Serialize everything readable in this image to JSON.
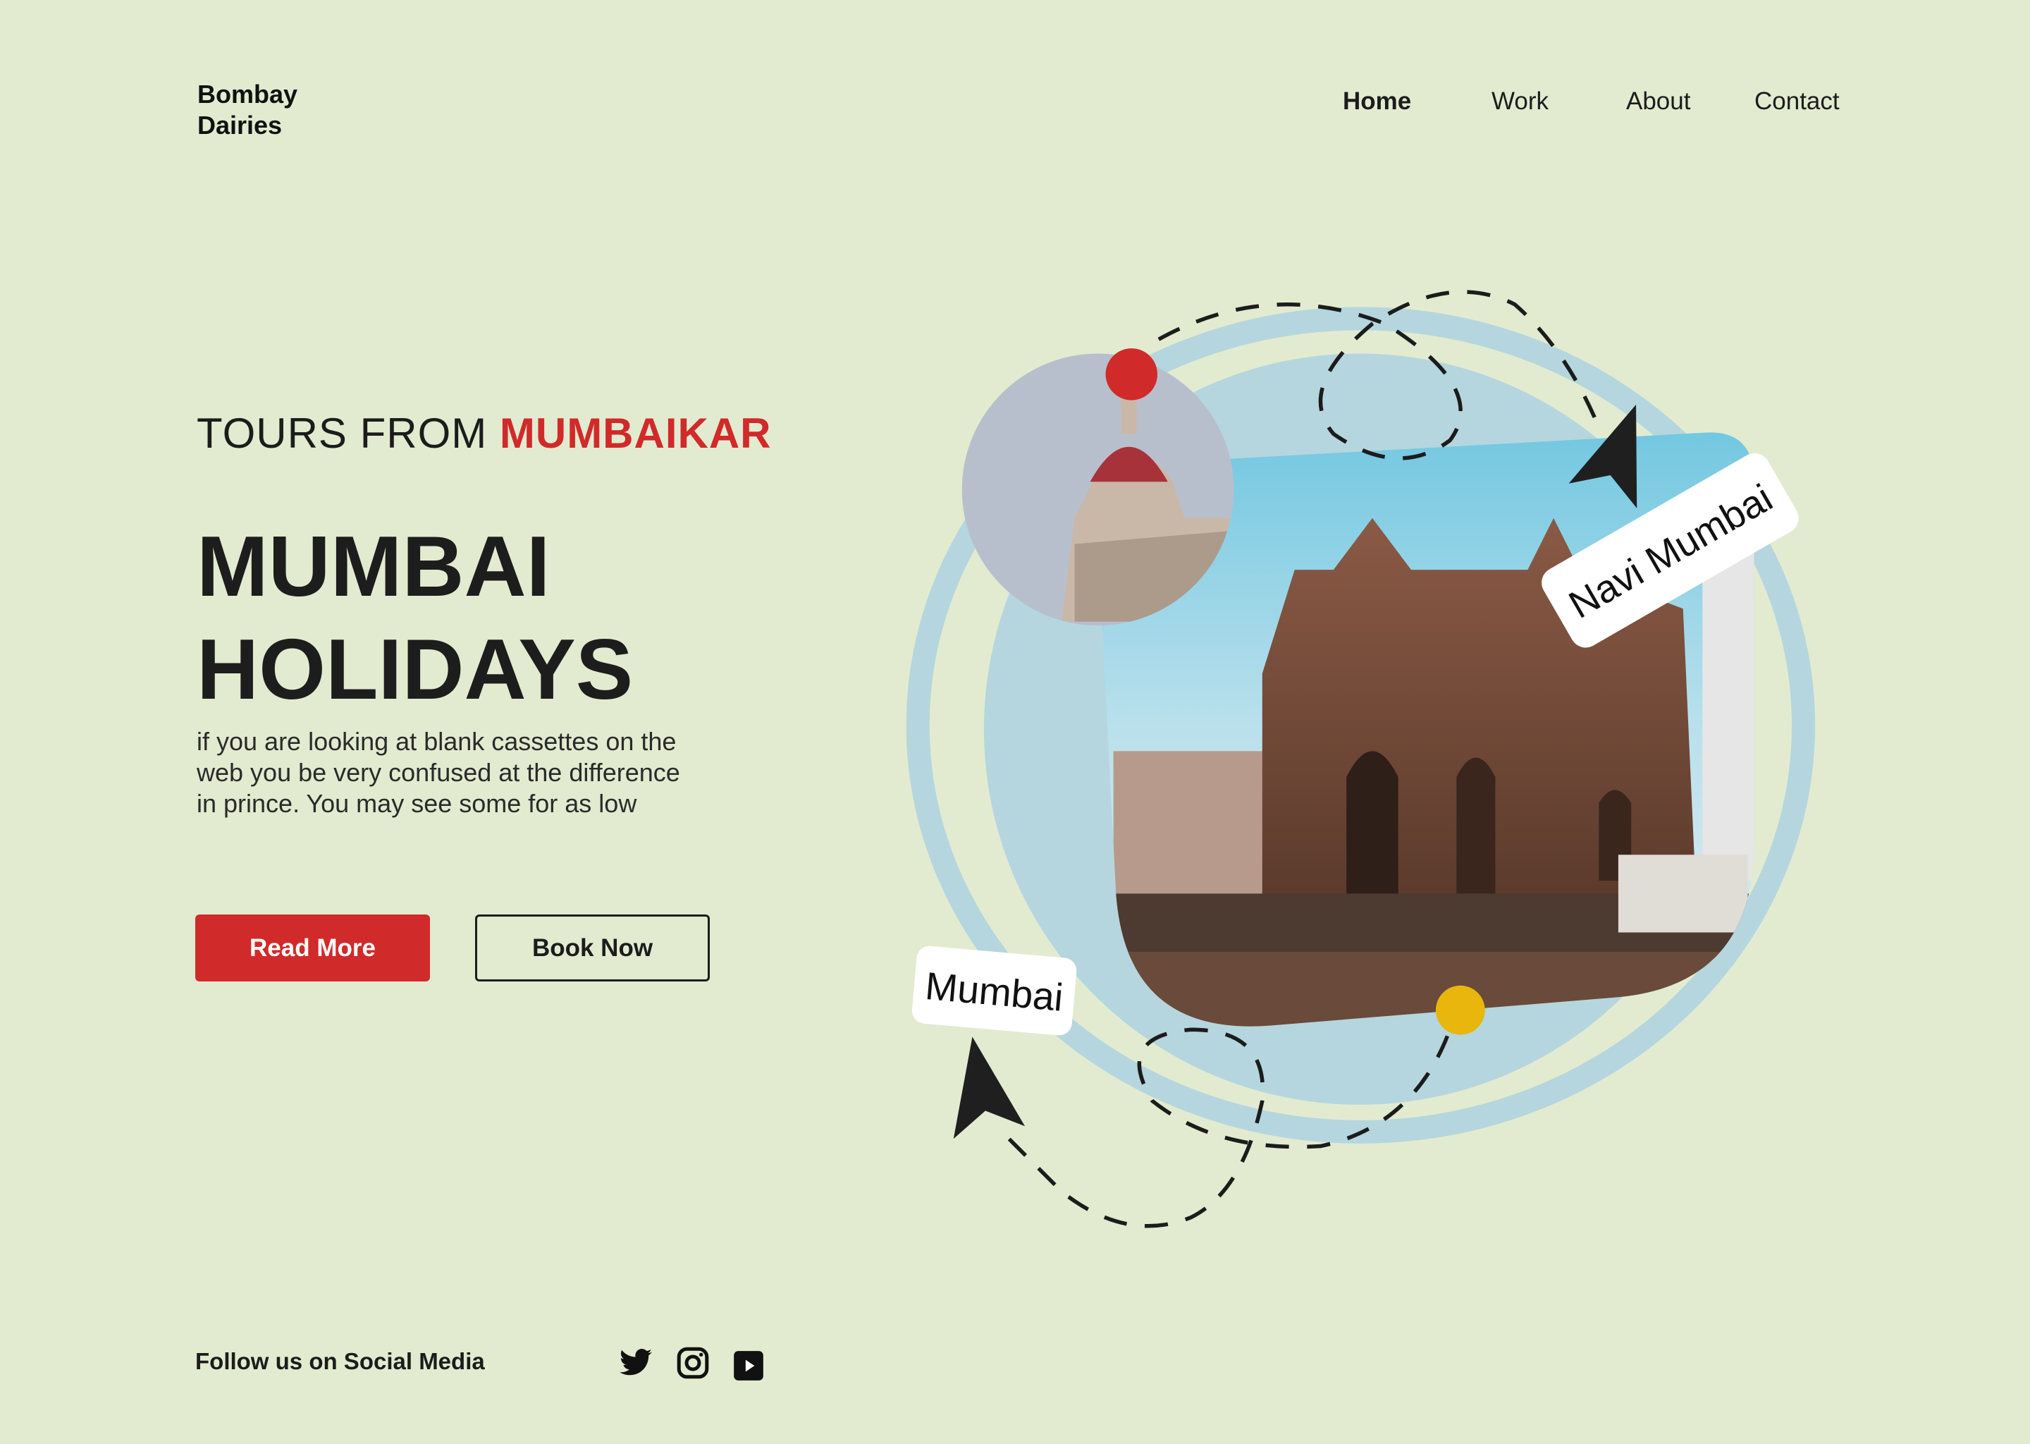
{
  "brand": {
    "line1": "Bombay",
    "line2": "Dairies"
  },
  "nav": {
    "items": [
      {
        "label": "Home",
        "active": true
      },
      {
        "label": "Work"
      },
      {
        "label": "About"
      },
      {
        "label": "Contact"
      }
    ]
  },
  "hero": {
    "kicker_prefix": "TOURS FROM ",
    "kicker_accent": "MUMBAIKAR",
    "title_line1": "MUMBAI",
    "title_line2": "HOLIDAYS",
    "description": "if you are looking at blank cassettes on the web you be very confused at the difference in prince. You may see some for as low",
    "read_more": "Read More",
    "book_now": "Book Now"
  },
  "illustration": {
    "label_navi": "Navi Mumbai",
    "label_mumbai": "Mumbai"
  },
  "footer": {
    "follow": "Follow us on Social Media",
    "icons": [
      "twitter-icon",
      "instagram-icon",
      "youtube-icon"
    ]
  },
  "colors": {
    "background": "#e2ebd0",
    "accent": "#d12a2a",
    "ring": "#b5d6de",
    "yellow": "#e8b60c",
    "dark": "#1c1c1c"
  }
}
